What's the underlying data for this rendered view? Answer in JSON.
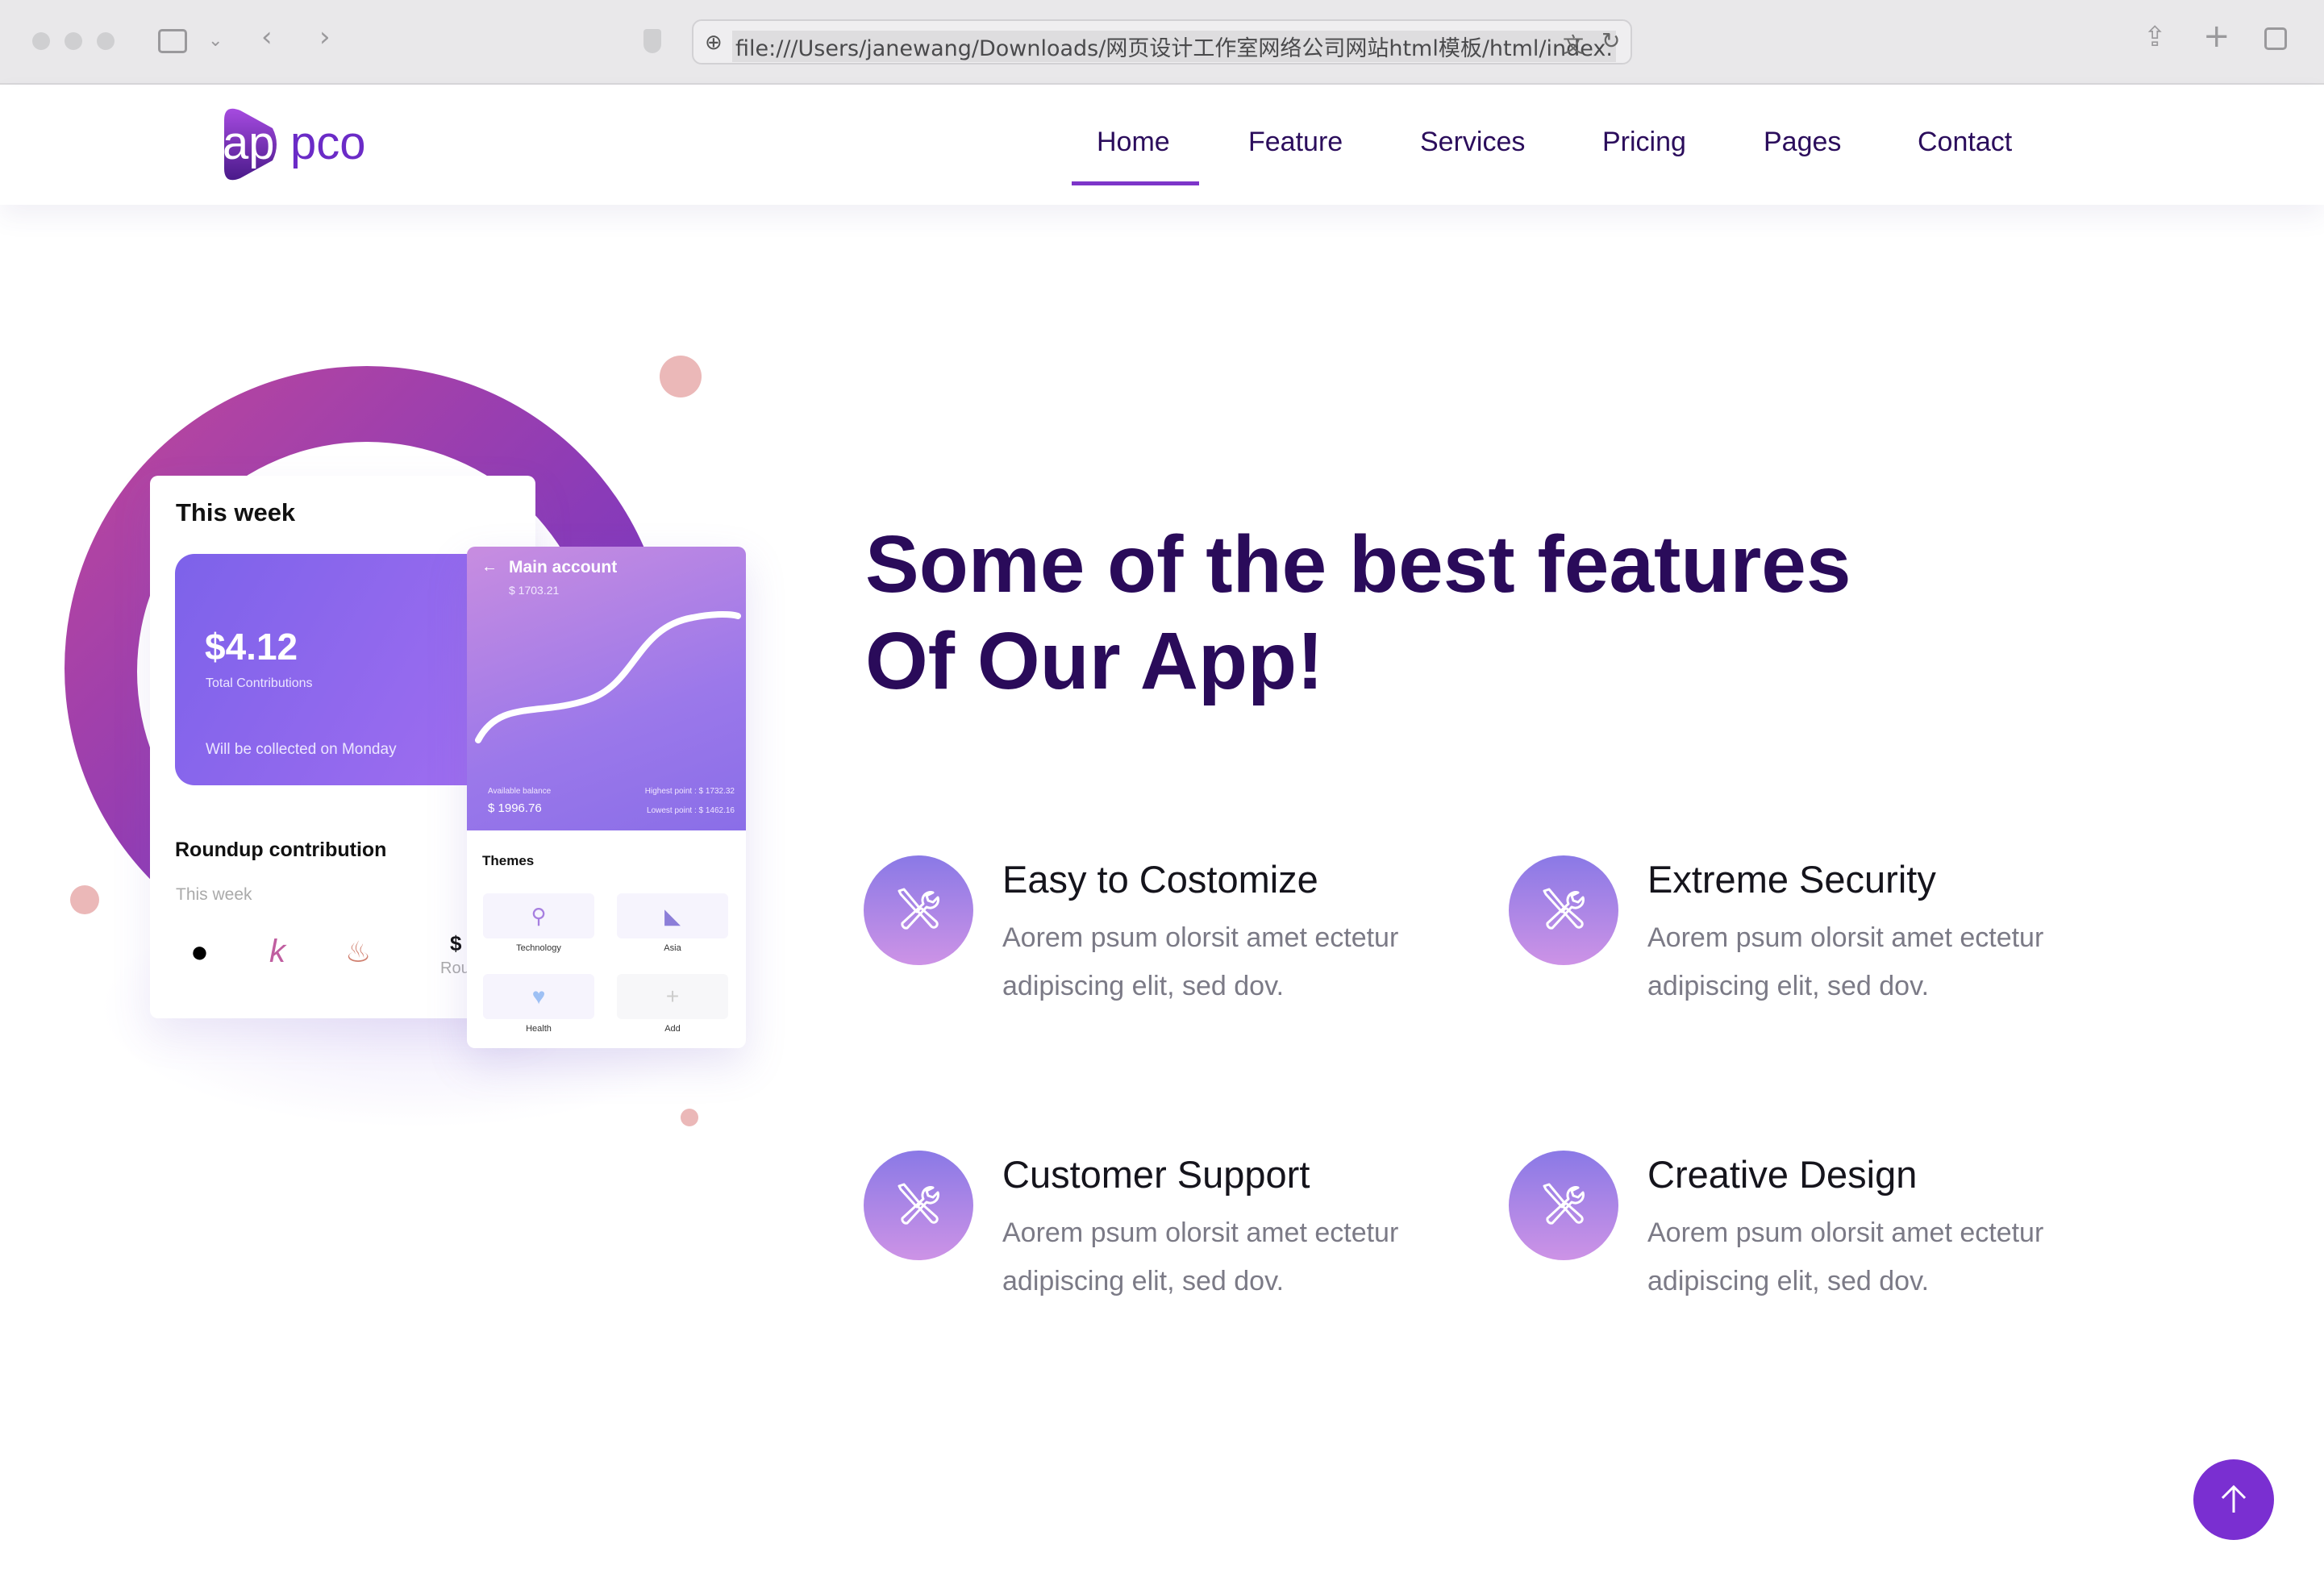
{
  "browser": {
    "url": "file:///Users/janewang/Downloads/网页设计工作室网络公司网站html模板/html/index."
  },
  "nav": {
    "logo": "appco",
    "items": [
      "Home",
      "Feature",
      "Services",
      "Pricing",
      "Pages",
      "Contact"
    ],
    "active": "Home"
  },
  "hero": {
    "heading_line1": "Some of the best features",
    "heading_line2": "Of Our App!"
  },
  "features": [
    {
      "title": "Easy to Costomize",
      "desc": "Aorem psum olorsit amet ectetur adipiscing elit, sed dov.",
      "icon": "tools-icon"
    },
    {
      "title": "Extreme Security",
      "desc": "Aorem psum olorsit amet ectetur adipiscing elit, sed dov.",
      "icon": "tools-icon"
    },
    {
      "title": "Customer Support",
      "desc": "Aorem psum olorsit amet ectetur adipiscing elit, sed dov.",
      "icon": "tools-icon"
    },
    {
      "title": "Creative Design",
      "desc": "Aorem psum olorsit amet ectetur adipiscing elit, sed dov.",
      "icon": "tools-icon"
    }
  ],
  "mockup": {
    "card1": {
      "title": "This week",
      "amount": "$4.12",
      "amount_label": "Total Contributions",
      "note": "Will be collected on Monday",
      "roundup": "Roundup contribution",
      "roundup_sub": "This week",
      "partial_dollar": "$",
      "partial_text": "Rou"
    },
    "card2": {
      "title": "Main account",
      "balance_top": "$ 1703.21",
      "available_label": "Available balance",
      "available": "$ 1996.76",
      "highest": "Highest point : $ 1732.32",
      "lowest": "Lowest point : $ 1462.16",
      "themes_title": "Themes",
      "themes": [
        "Technology",
        "Asia",
        "Health",
        "Add"
      ]
    }
  },
  "colors": {
    "brand": "#7a2fd1",
    "heading": "#2a0b5a"
  }
}
